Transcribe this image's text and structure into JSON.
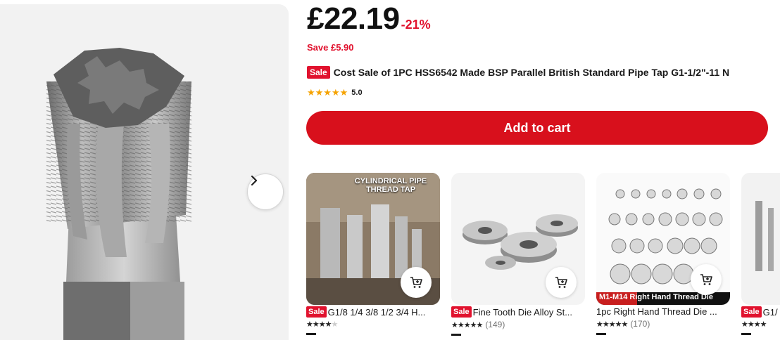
{
  "product": {
    "price": "£22.19",
    "discount": "-21%",
    "save": "Save £5.90",
    "sale_badge": "Sale",
    "title": "Cost Sale of 1PC HSS6542 Made BSP Parallel British Standard Pipe Tap G1-1/2\"-11 N",
    "rating_stars": 5,
    "rating_value": "5.0",
    "add_to_cart": "Add to cart",
    "image_icon": "pipe-tap-image"
  },
  "gallery": {
    "next_icon": "chevron-right-icon"
  },
  "recommendations": [
    {
      "sale": "Sale",
      "name": "G1/8 1/4 3/8 1/2 3/4 H...",
      "stars": 4,
      "count": "",
      "image_text": "CYLINDRICAL PIPE THREAD TAP"
    },
    {
      "sale": "Sale",
      "name": "Fine Tooth Die Alloy St...",
      "stars": 5,
      "count": "(149)",
      "image_text": ""
    },
    {
      "sale": "",
      "name": "1pc Right Hand Thread Die ...",
      "stars": 5,
      "count": "(170)",
      "image_text": "M1-M14  Right Hand Thread Die"
    },
    {
      "sale": "Sale",
      "name": "G1/",
      "stars": 4,
      "count": "",
      "image_text": ""
    }
  ],
  "colors": {
    "accent": "#d8101c",
    "sale": "#e1122e",
    "star": "#f5a300"
  }
}
